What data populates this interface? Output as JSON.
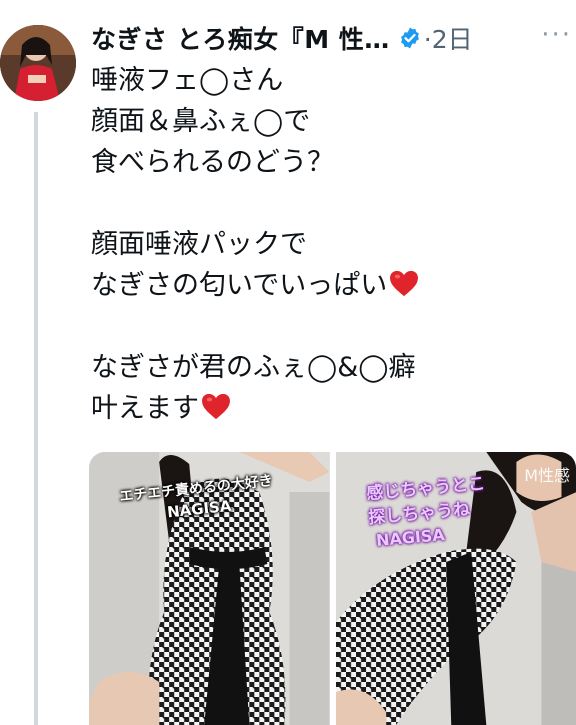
{
  "author": {
    "display_name": "なぎさ とろ痴女『M 性…",
    "timestamp": "·2日",
    "more_label": "···"
  },
  "tweet": {
    "lines": [
      "唾液フェ◯さん",
      "顔面＆鼻ふぇ◯で",
      "食べられるのどう？",
      "",
      "顔面唾液パックで",
      "なぎさの匂いでいっぱい",
      "",
      "なぎさが君のふぇ◯&◯癖",
      "叶えます"
    ]
  },
  "media": {
    "left": {
      "caption_line1": "エチエチ責めるの大好き",
      "caption_line2": "NAGISA"
    },
    "right": {
      "watermark": "M性感",
      "caption_line1": "感じちゃうとこ",
      "caption_line2": "探しちゃうね",
      "caption_line3": "NAGISA"
    }
  },
  "icons": {
    "verified": "verified-badge-icon",
    "heart": "red-heart-emoji",
    "more": "more-dots-icon"
  },
  "colors": {
    "verified": "#1d9bf0",
    "heart": "#e0242c",
    "timestamp": "#536471",
    "thread_line": "#cfd9de"
  }
}
